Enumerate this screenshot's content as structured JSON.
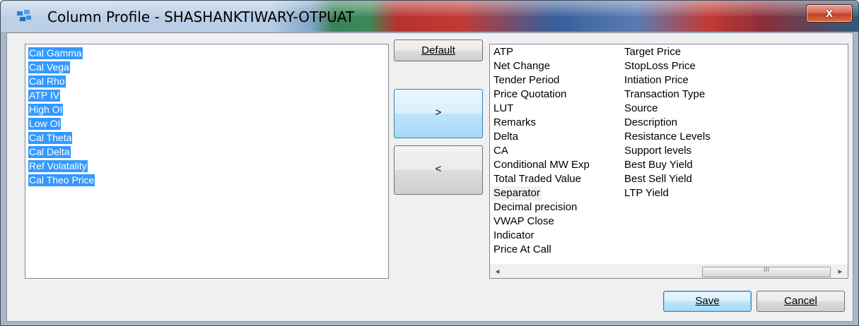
{
  "window": {
    "title": "Column Profile - SHASHANKTIWARY-OTPUAT",
    "close_label": "x"
  },
  "left_list": {
    "items": [
      "Cal Gamma",
      "Cal Vega",
      "Cal Rho",
      "ATP IV",
      "High OI",
      "Low OI",
      "Cal Theta",
      "Cal Delta",
      "Ref Volatality",
      "Cal Theo Price"
    ]
  },
  "buttons": {
    "default_label": "Default",
    "add_label": ">",
    "remove_label": "<",
    "save_label": "Save",
    "cancel_label": "Cancel"
  },
  "right_list": {
    "column1": [
      "ATP",
      "Net Change",
      "Tender Period",
      "Price  Quotation",
      "LUT",
      "Remarks",
      "Delta",
      "CA",
      "Conditional MW Exp",
      "Total Traded Value",
      "Separator",
      "Decimal precision",
      "VWAP Close",
      "Indicator",
      "Price At Call"
    ],
    "column2": [
      "Target Price",
      "StopLoss Price",
      "Intiation Price",
      "Transaction Type",
      "Source",
      "Description",
      "Resistance Levels",
      "Support levels",
      "Best Buy Yield",
      "Best Sell Yield",
      "LTP Yield"
    ],
    "selected": "Separator"
  },
  "scrollbar": {
    "left_arrow": "◄",
    "right_arrow": "►",
    "grip": "III"
  },
  "colors": {
    "selection": "#3399ff"
  }
}
